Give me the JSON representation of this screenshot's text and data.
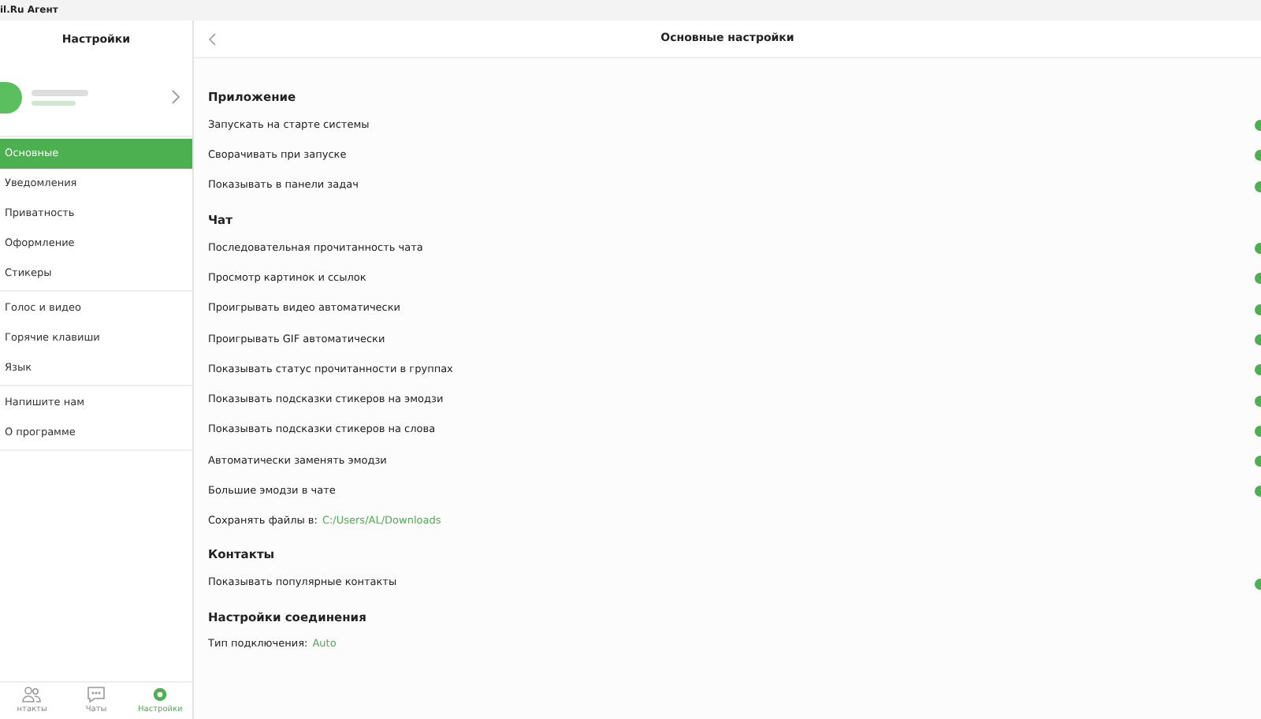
{
  "window": {
    "title": "il.Ru Агент"
  },
  "sidebar": {
    "title": "Настройки",
    "groups": [
      [
        {
          "label": "Основные",
          "selected": true
        },
        {
          "label": "Уведомления",
          "selected": false
        },
        {
          "label": "Приватность",
          "selected": false
        },
        {
          "label": "Оформление",
          "selected": false
        },
        {
          "label": "Стикеры",
          "selected": false
        }
      ],
      [
        {
          "label": "Голос и видео",
          "selected": false
        },
        {
          "label": "Горячие клавиши",
          "selected": false
        },
        {
          "label": "Язык",
          "selected": false
        }
      ],
      [
        {
          "label": "Напишите нам",
          "selected": false
        },
        {
          "label": "О программе",
          "selected": false
        }
      ]
    ]
  },
  "bottom_tabs": [
    {
      "label": "нтакты",
      "kind": "contacts",
      "selected": false
    },
    {
      "label": "Чаты",
      "kind": "chats",
      "selected": false
    },
    {
      "label": "Настройки",
      "kind": "settings",
      "selected": true
    }
  ],
  "main": {
    "title": "Основные настройки",
    "sections": [
      {
        "title": "Приложение",
        "items": [
          {
            "kind": "toggle",
            "label": "Запускать на старте системы",
            "on": true
          },
          {
            "kind": "toggle",
            "label": "Сворачивать при запуске",
            "on": true
          },
          {
            "kind": "toggle",
            "label": "Показывать в панели задач",
            "on": true
          }
        ]
      },
      {
        "title": "Чат",
        "items": [
          {
            "kind": "toggle",
            "label": "Последовательная прочитанность чата",
            "on": true
          },
          {
            "kind": "toggle",
            "label": "Просмотр картинок и ссылок",
            "on": true
          },
          {
            "kind": "toggle",
            "label": "Проигрывать видео автоматически",
            "on": true
          },
          {
            "kind": "toggle",
            "label": "Проигрывать GIF автоматически",
            "on": true
          },
          {
            "kind": "toggle",
            "label": "Показывать статус прочитанности в группах",
            "on": true
          },
          {
            "kind": "toggle",
            "label": "Показывать подсказки стикеров на эмодзи",
            "on": true
          },
          {
            "kind": "toggle",
            "label": "Показывать подсказки стикеров на слова",
            "on": true
          },
          {
            "kind": "toggle",
            "label": "Автоматически заменять эмодзи",
            "on": true
          },
          {
            "kind": "toggle",
            "label": "Большие эмодзи в чате",
            "on": true
          },
          {
            "kind": "link",
            "label": "Сохранять файлы в:",
            "value": "C:/Users/AL/Downloads"
          }
        ]
      },
      {
        "title": "Контакты",
        "items": [
          {
            "kind": "toggle",
            "label": "Показывать популярные контакты",
            "on": true
          }
        ]
      },
      {
        "title": "Настройки соединения",
        "items": [
          {
            "kind": "link",
            "label": "Тип подключения:",
            "value": "Auto"
          }
        ]
      }
    ]
  }
}
